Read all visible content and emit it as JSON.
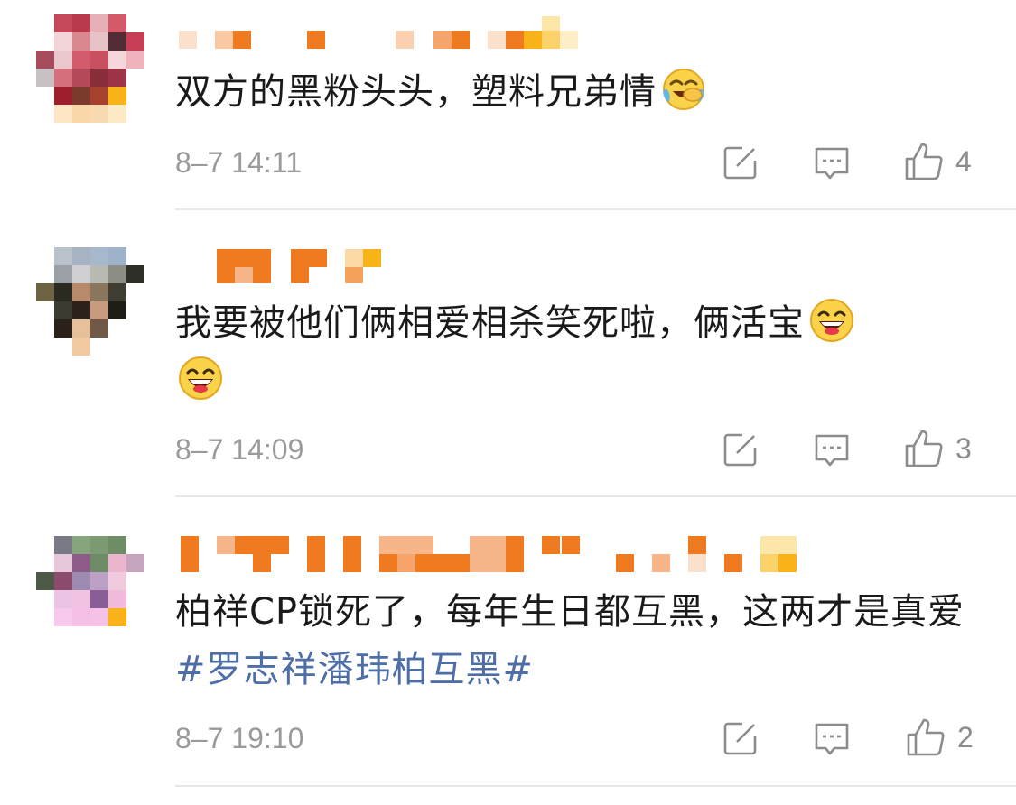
{
  "comments": [
    {
      "text": "双方的黑粉头头，塑料兄弟情",
      "hashtag": "",
      "emoji": "laugh-cry",
      "time": "8–7 14:11",
      "likes": "4"
    },
    {
      "text": "我要被他们俩相爱相杀笑死啦，俩活宝",
      "hashtag": "",
      "emoji": "grin",
      "time": "8–7 14:09",
      "likes": "3"
    },
    {
      "text": "柏祥CP锁死了，每年生日都互黑，这两才是真爱",
      "hashtag": "#罗志祥潘玮柏互黑#",
      "emoji": "",
      "time": "8–7 19:10",
      "likes": "2"
    }
  ],
  "icons": {
    "forward": "share-edit-icon",
    "comment": "comment-icon",
    "like": "thumbs-up-icon"
  },
  "colors": {
    "hashtag": "#4e6ea8",
    "username_blur": "#f07a1f",
    "meta": "#9a9a9a"
  }
}
